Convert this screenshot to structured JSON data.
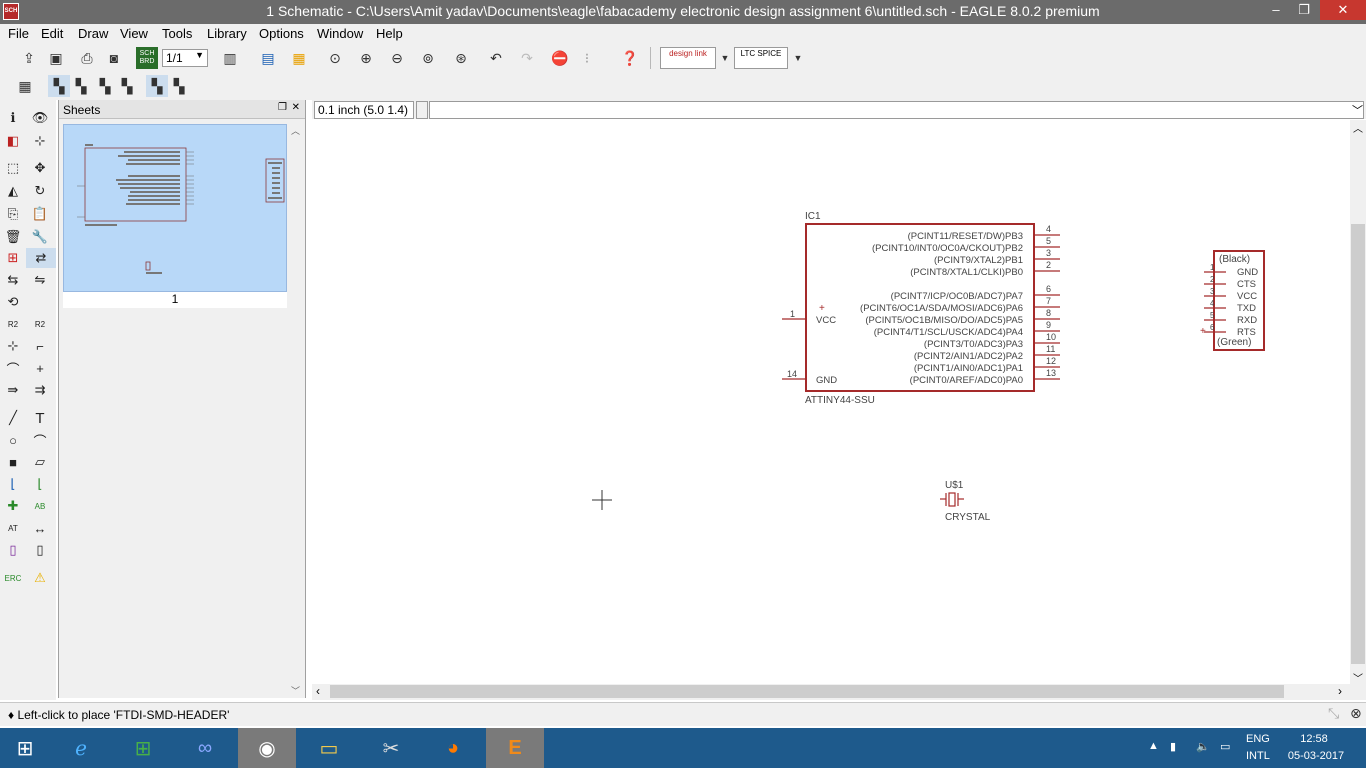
{
  "window": {
    "title": "1 Schematic - C:\\Users\\Amit yadav\\Documents\\eagle\\fabacademy electronic design assignment 6\\untitled.sch - EAGLE 8.0.2 premium",
    "app_icon_label": "SCH",
    "minimize": "–",
    "restore": "❐",
    "close": "✕"
  },
  "menu": [
    "File",
    "Edit",
    "Draw",
    "View",
    "Tools",
    "Library",
    "Options",
    "Window",
    "Help"
  ],
  "toolbar": {
    "sheet_select": "1/1",
    "design_link": "design link",
    "ltspice": "LTC SPICE",
    "sch_brd": "SCH BRD"
  },
  "sheets_panel": {
    "title": "Sheets",
    "sheet_number": "1"
  },
  "coord_readout": "0.1 inch (5.0 1.4)",
  "command_input": "",
  "schematic": {
    "ic": {
      "name": "IC1",
      "value": "ATTINY44-SSU",
      "left_pins": [
        {
          "num": "1",
          "label": "VCC"
        },
        {
          "num": "14",
          "label": "GND"
        }
      ],
      "right_pins": [
        {
          "num": "4",
          "label": "(PCINT11/RESET/DW)PB3"
        },
        {
          "num": "5",
          "label": "(PCINT10/INT0/OC0A/CKOUT)PB2"
        },
        {
          "num": "3",
          "label": "(PCINT9/XTAL2)PB1"
        },
        {
          "num": "2",
          "label": "(PCINT8/XTAL1/CLKI)PB0"
        },
        {
          "num": "6",
          "label": "(PCINT7/ICP/OC0B/ADC7)PA7"
        },
        {
          "num": "7",
          "label": "(PCINT6/OC1A/SDA/MOSI/ADC6)PA6"
        },
        {
          "num": "8",
          "label": "(PCINT5/OC1B/MISO/DO/ADC5)PA5"
        },
        {
          "num": "9",
          "label": "(PCINT4/T1/SCL/USCK/ADC4)PA4"
        },
        {
          "num": "10",
          "label": "(PCINT3/T0/ADC3)PA3"
        },
        {
          "num": "11",
          "label": "(PCINT2/AIN1/ADC2)PA2"
        },
        {
          "num": "12",
          "label": "(PCINT1/AIN0/ADC1)PA1"
        },
        {
          "num": "13",
          "label": "(PCINT0/AREF/ADC0)PA0"
        }
      ]
    },
    "header": {
      "top_label": "(Black)",
      "bottom_label": "(Green)",
      "pins": [
        {
          "num": "1",
          "label": "GND"
        },
        {
          "num": "2",
          "label": "CTS"
        },
        {
          "num": "3",
          "label": "VCC"
        },
        {
          "num": "4",
          "label": "TXD"
        },
        {
          "num": "5",
          "label": "RXD"
        },
        {
          "num": "6",
          "label": "RTS"
        }
      ]
    },
    "crystal": {
      "name": "U$1",
      "value": "CRYSTAL"
    }
  },
  "status": "♦ Left-click to place 'FTDI-SMD-HEADER'",
  "taskbar": {
    "lang_top": "ENG",
    "lang_bottom": "INTL",
    "time": "12:58",
    "date": "05-03-2017"
  },
  "colors": {
    "schematic_outline": "#a52a2a",
    "schematic_text": "#444444",
    "taskbar": "#1e5a8c",
    "titlebar": "#6b6b6b",
    "close_button": "#c7372f"
  }
}
